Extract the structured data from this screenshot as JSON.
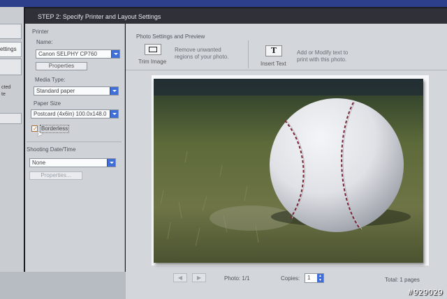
{
  "header": {
    "title": "STEP 2: Specify Printer and Layout Settings"
  },
  "left_strip": {
    "settings_tab": "ettings",
    "partial_text_1": "cted",
    "partial_text_2": "te"
  },
  "printer": {
    "section_label": "Printer",
    "name_label": "Name:",
    "name_value": "Canon SELPHY CP760",
    "properties_button": "Properties",
    "media_type_label": "Media Type:",
    "media_type_value": "Standard paper",
    "paper_size_label": "Paper Size",
    "paper_size_value": "Postcard (4x6in) 100.0x148.0",
    "borderless_label": "Borderless",
    "borderless_checked": true
  },
  "shooting": {
    "label": "Shooting Date/Time",
    "value": "None",
    "properties_button": "Properties..."
  },
  "photo_settings": {
    "title": "Photo Settings and Preview",
    "trim_label": "Trim Image",
    "trim_desc_1": "Remove unwanted",
    "trim_desc_2": "regions of your photo.",
    "insert_label": "Insert Text",
    "insert_icon": "T",
    "insert_desc_1": "Add or Modify text to",
    "insert_desc_2": "print with this photo."
  },
  "footer": {
    "photo_counter": "Photo: 1/1",
    "copies_label": "Copies:",
    "copies_value": "1",
    "total_pages": "Total: 1 pages"
  },
  "watermark": "#929029",
  "colors": {
    "accent": "#3f6fd6",
    "title_bar": "#2f3038",
    "panel": "#cfd2d7"
  }
}
